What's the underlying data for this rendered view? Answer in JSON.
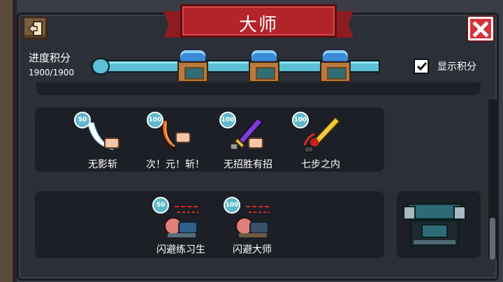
{
  "title": "大师",
  "progress": {
    "label": "进度积分",
    "count_text": "1900/1900",
    "fraction": 1.0
  },
  "show_points": {
    "label": "显示积分",
    "checked": true
  },
  "rows": [
    {
      "skills": [
        {
          "badge": "50",
          "label": "无影斩",
          "icon": "white-slash-icon"
        },
        {
          "badge": "100",
          "label": "次！元！斩！",
          "icon": "orange-slash-icon"
        },
        {
          "badge": "100",
          "label": "无招胜有招",
          "icon": "purple-sword-icon"
        },
        {
          "badge": "100",
          "label": "七步之内",
          "icon": "golden-sword-icon"
        }
      ]
    },
    {
      "skills": [
        {
          "badge": "50",
          "label": "闪避练习生",
          "icon": "dodge-trainee-icon"
        },
        {
          "badge": "100",
          "label": "闪避大师",
          "icon": "dodge-master-icon"
        }
      ]
    }
  ],
  "colors": {
    "banner": "#b3242a",
    "bar": "#5cc1d6",
    "close": "#d8313a",
    "panel": "#2b2f37"
  }
}
